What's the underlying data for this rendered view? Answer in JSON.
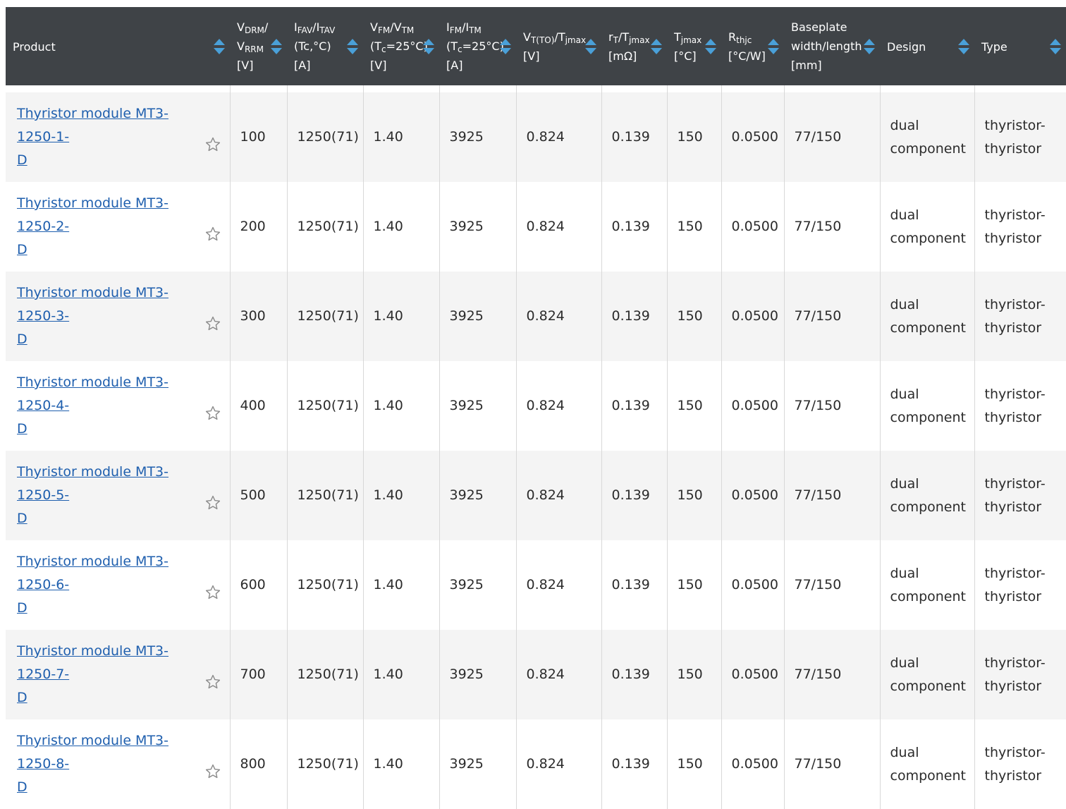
{
  "headers": {
    "product": "Product",
    "vdrm_main": "V",
    "vdrm_sub": "DRM",
    "vdrm_sep": "/",
    "vrrm_main": "V",
    "vrrm_sub": "RRM",
    "vdrm_unit": "[V]",
    "ifav_a": "I",
    "ifav_a_sub": "FAV",
    "ifav_sep": "/I",
    "ifav_b_sub": "TAV",
    "ifav_cond": "(Tc,°C)",
    "ifav_unit": "[A]",
    "vfm_a": "V",
    "vfm_a_sub": "FM",
    "vfm_sep": "/V",
    "vfm_b_sub": "TM",
    "vfm_cond_a": "(T",
    "vfm_cond_sub": "c",
    "vfm_cond_b": "=25°C)",
    "vfm_unit": "[V]",
    "ifm_a": "I",
    "ifm_a_sub": "FM",
    "ifm_sep": "/I",
    "ifm_b_sub": "TM",
    "ifm_cond_a": "(T",
    "ifm_cond_sub": "c",
    "ifm_cond_b": "=25°C)",
    "ifm_unit": "[A]",
    "vto_a": "V",
    "vto_a_sub": "T(TO)",
    "vto_sep": "/T",
    "vto_b_sub": "jmax",
    "vto_unit": "[V]",
    "rt_a": "r",
    "rt_a_sub": "T",
    "rt_sep": "/T",
    "rt_b_sub": "jmax",
    "rt_unit": "[mΩ]",
    "tj_a": "T",
    "tj_sub": "jmax",
    "tj_unit": "[°C]",
    "rth_a": "R",
    "rth_sub": "thjc",
    "rth_unit": "[°C/W]",
    "base_line1": "Baseplate",
    "base_line2": "width/length",
    "base_unit": "[mm]",
    "design": "Design",
    "type": "Type"
  },
  "rows": [
    {
      "product_line1": "Thyristor module MT3-1250-1-",
      "product_line2": "D",
      "vdrm": "100",
      "ifav": "1250(71)",
      "vfm": "1.40",
      "ifm": "3925",
      "vto": "0.824",
      "rt": "0.139",
      "tj": "150",
      "rth": "0.0500",
      "base": "77/150",
      "design_line1": "dual",
      "design_line2": "component",
      "type_line1": "thyristor-",
      "type_line2": "thyristor"
    },
    {
      "product_line1": "Thyristor module MT3-1250-2-",
      "product_line2": "D",
      "vdrm": "200",
      "ifav": "1250(71)",
      "vfm": "1.40",
      "ifm": "3925",
      "vto": "0.824",
      "rt": "0.139",
      "tj": "150",
      "rth": "0.0500",
      "base": "77/150",
      "design_line1": "dual",
      "design_line2": "component",
      "type_line1": "thyristor-",
      "type_line2": "thyristor"
    },
    {
      "product_line1": "Thyristor module MT3-1250-3-",
      "product_line2": "D",
      "vdrm": "300",
      "ifav": "1250(71)",
      "vfm": "1.40",
      "ifm": "3925",
      "vto": "0.824",
      "rt": "0.139",
      "tj": "150",
      "rth": "0.0500",
      "base": "77/150",
      "design_line1": "dual",
      "design_line2": "component",
      "type_line1": "thyristor-",
      "type_line2": "thyristor"
    },
    {
      "product_line1": "Thyristor module MT3-1250-4-",
      "product_line2": "D",
      "vdrm": "400",
      "ifav": "1250(71)",
      "vfm": "1.40",
      "ifm": "3925",
      "vto": "0.824",
      "rt": "0.139",
      "tj": "150",
      "rth": "0.0500",
      "base": "77/150",
      "design_line1": "dual",
      "design_line2": "component",
      "type_line1": "thyristor-",
      "type_line2": "thyristor"
    },
    {
      "product_line1": "Thyristor module MT3-1250-5-",
      "product_line2": "D",
      "vdrm": "500",
      "ifav": "1250(71)",
      "vfm": "1.40",
      "ifm": "3925",
      "vto": "0.824",
      "rt": "0.139",
      "tj": "150",
      "rth": "0.0500",
      "base": "77/150",
      "design_line1": "dual",
      "design_line2": "component",
      "type_line1": "thyristor-",
      "type_line2": "thyristor"
    },
    {
      "product_line1": "Thyristor module MT3-1250-6-",
      "product_line2": "D",
      "vdrm": "600",
      "ifav": "1250(71)",
      "vfm": "1.40",
      "ifm": "3925",
      "vto": "0.824",
      "rt": "0.139",
      "tj": "150",
      "rth": "0.0500",
      "base": "77/150",
      "design_line1": "dual",
      "design_line2": "component",
      "type_line1": "thyristor-",
      "type_line2": "thyristor"
    },
    {
      "product_line1": "Thyristor module MT3-1250-7-",
      "product_line2": "D",
      "vdrm": "700",
      "ifav": "1250(71)",
      "vfm": "1.40",
      "ifm": "3925",
      "vto": "0.824",
      "rt": "0.139",
      "tj": "150",
      "rth": "0.0500",
      "base": "77/150",
      "design_line1": "dual",
      "design_line2": "component",
      "type_line1": "thyristor-",
      "type_line2": "thyristor"
    },
    {
      "product_line1": "Thyristor module MT3-1250-8-",
      "product_line2": "D",
      "vdrm": "800",
      "ifav": "1250(71)",
      "vfm": "1.40",
      "ifm": "3925",
      "vto": "0.824",
      "rt": "0.139",
      "tj": "150",
      "rth": "0.0500",
      "base": "77/150",
      "design_line1": "dual",
      "design_line2": "component",
      "type_line1": "thyristor-",
      "type_line2": "thyristor"
    }
  ],
  "icons": {
    "sort": "sort-arrows-icon",
    "favorite": "star-outline-icon"
  },
  "colors": {
    "header_bg": "#3f4347",
    "sort_arrow": "#4aa0d8",
    "link": "#1f5fae",
    "row_alt": "#f4f4f4"
  }
}
